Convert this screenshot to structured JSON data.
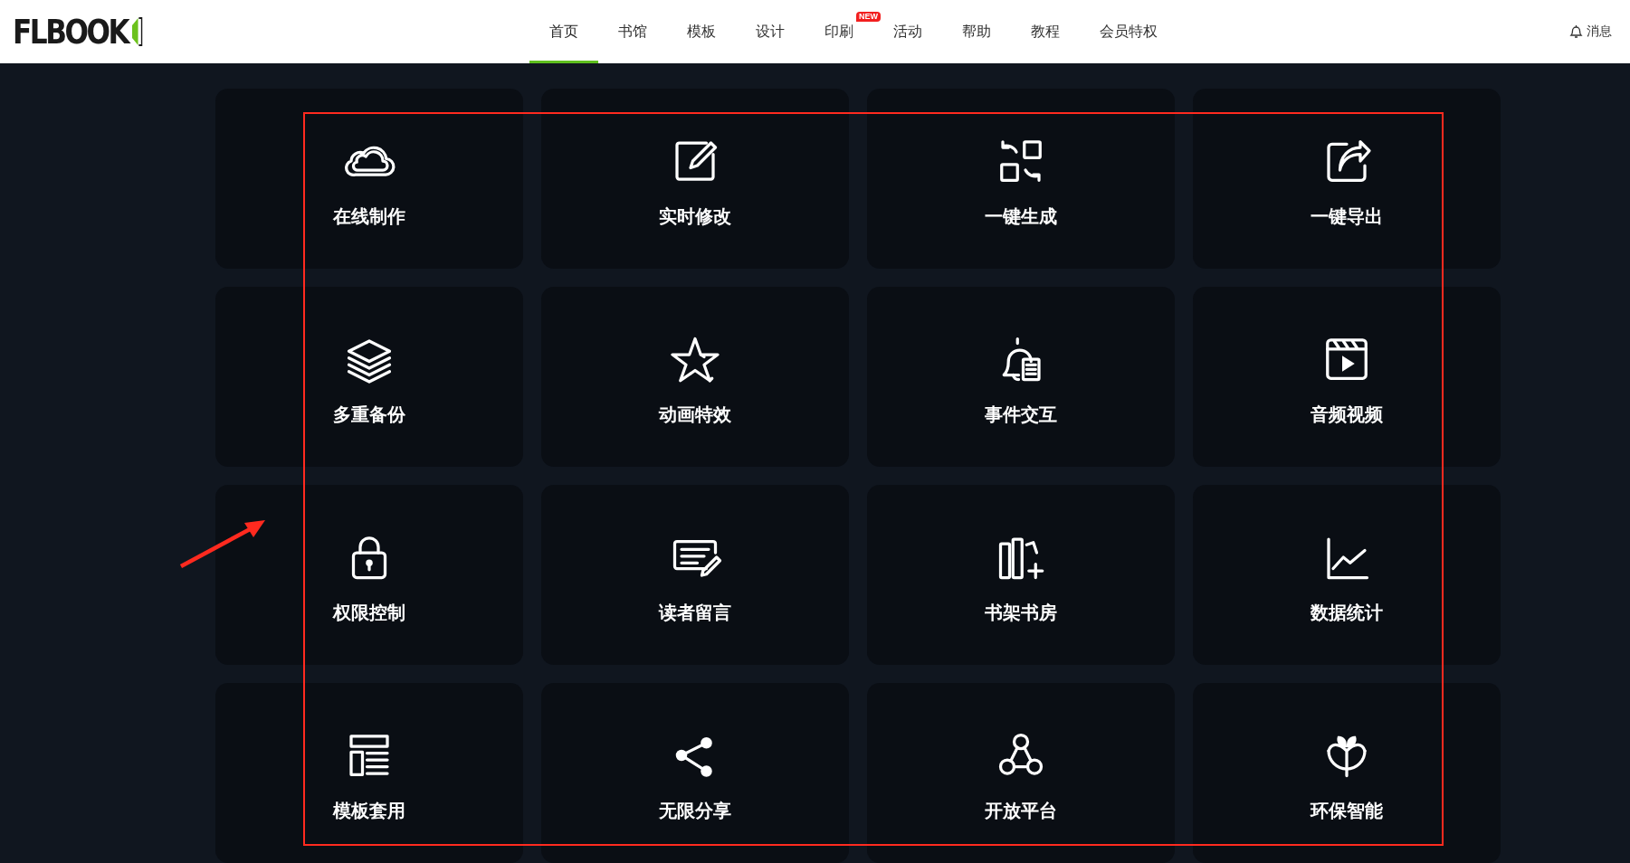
{
  "header": {
    "logo": "FLBOOK",
    "nav": [
      {
        "label": "首页",
        "selected": true
      },
      {
        "label": "书馆",
        "selected": false
      },
      {
        "label": "模板",
        "selected": false
      },
      {
        "label": "设计",
        "selected": false
      },
      {
        "label": "印刷",
        "selected": false,
        "badge": "NEW"
      },
      {
        "label": "活动",
        "selected": false
      },
      {
        "label": "帮助",
        "selected": false
      },
      {
        "label": "教程",
        "selected": false
      },
      {
        "label": "会员特权",
        "selected": false
      }
    ],
    "messages": "消息"
  },
  "features": [
    {
      "label": "在线制作"
    },
    {
      "label": "实时修改"
    },
    {
      "label": "一键生成"
    },
    {
      "label": "一键导出"
    },
    {
      "label": "多重备份"
    },
    {
      "label": "动画特效"
    },
    {
      "label": "事件交互"
    },
    {
      "label": "音频视频"
    },
    {
      "label": "权限控制"
    },
    {
      "label": "读者留言"
    },
    {
      "label": "书架书房"
    },
    {
      "label": "数据统计"
    },
    {
      "label": "模板套用"
    },
    {
      "label": "无限分享"
    },
    {
      "label": "开放平台"
    },
    {
      "label": "环保智能"
    }
  ],
  "highlight_box": {
    "color": "#ff2a1f"
  },
  "pointer_arrow": {
    "color": "#ff2a1f"
  }
}
